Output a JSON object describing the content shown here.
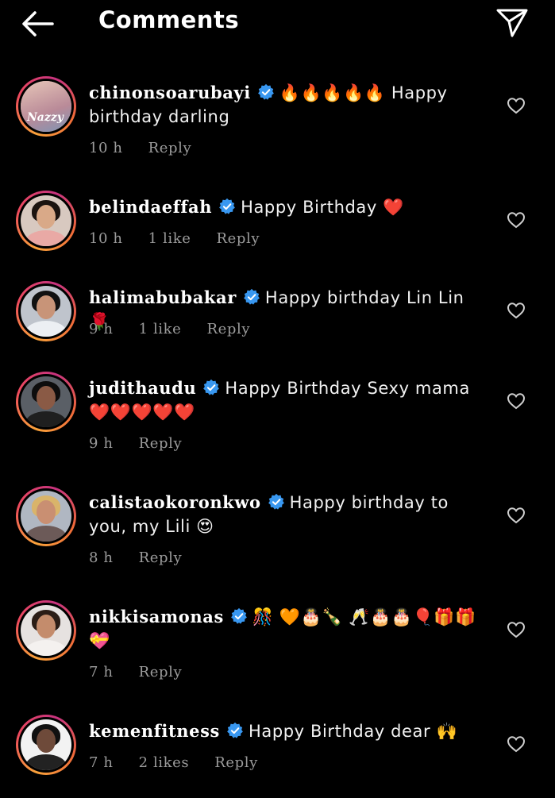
{
  "header": {
    "title": "Comments",
    "back_icon": "arrow-left-icon",
    "share_icon": "paper-plane-icon"
  },
  "colors": {
    "background": "#000000",
    "verified_badge": "#3897f0",
    "meta_text": "#9b9b9b",
    "story_ring_start": "#f9a23a",
    "story_ring_end": "#c7337f",
    "heart": "#e0243a"
  },
  "comments": [
    {
      "username": "chinonsoarubayi",
      "text": "🔥🔥🔥🔥🔥 Happy birthday darling",
      "time": "10 h",
      "likes": "",
      "reply": "Reply",
      "avatar_text": "Nazzy"
    },
    {
      "username": "belindaeffah",
      "text": "Happy Birthday ❤️",
      "time": "10 h",
      "likes": "1 like",
      "reply": "Reply"
    },
    {
      "username": "halimabubakar",
      "text": "Happy birthday Lin Lin 🌹",
      "time": "9 h",
      "likes": "1 like",
      "reply": "Reply"
    },
    {
      "username": "judithaudu",
      "text": "Happy Birthday Sexy mama ❤️❤️❤️❤️❤️",
      "time": "9 h",
      "likes": "",
      "reply": "Reply"
    },
    {
      "username": "calistaokoronkwo",
      "text": "Happy birthday to you, my Lili 😍",
      "time": "8 h",
      "likes": "",
      "reply": "Reply"
    },
    {
      "username": "nikkisamonas",
      "text": "🎊 🧡🎂🍾 🥂🎂🎂🎈🎁🎁💝",
      "time": "7 h",
      "likes": "",
      "reply": "Reply"
    },
    {
      "username": "kemenfitness",
      "text": "Happy Birthday dear 🙌",
      "time": "7 h",
      "likes": "2 likes",
      "reply": "Reply"
    }
  ]
}
